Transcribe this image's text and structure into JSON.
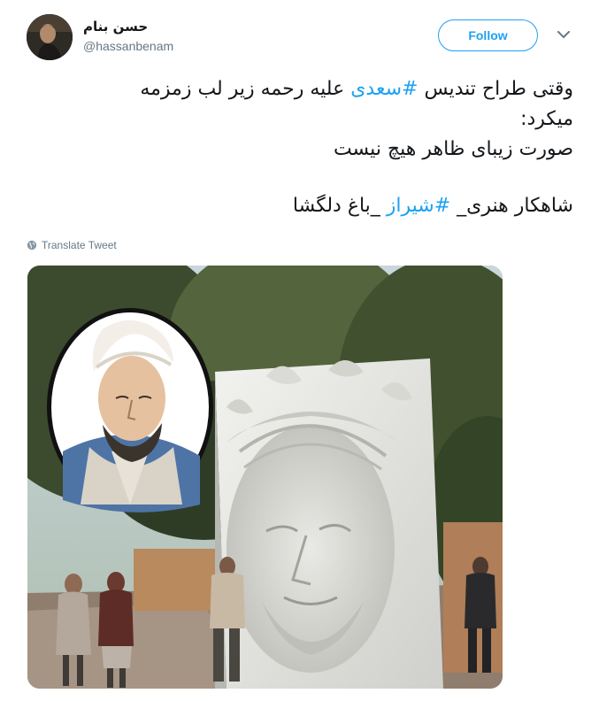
{
  "user": {
    "display_name": "حسن بنام",
    "handle": "@hassanbenam",
    "avatar_icon": "user-avatar-photo"
  },
  "actions": {
    "follow_label": "Follow",
    "more_icon": "chevron-down-icon"
  },
  "tweet": {
    "line1_pre": "وقتی طراح  تندیس ",
    "hashtag1": "#سعدی",
    "line1_post": " علیه رحمه زیر لب زمزمه",
    "line2": "میکرد:",
    "line3": "صورت زیبای ظاهر هیچ نیست",
    "line4_pre": "شاهکار هنری_ ",
    "hashtag2": "#شیراز",
    "line4_post": " _باغ دلگشا"
  },
  "translate_label": "Translate Tweet",
  "media": {
    "alt": "photo"
  },
  "colors": {
    "accent": "#1da1f2",
    "text": "#14171a",
    "secondary": "#657786"
  }
}
